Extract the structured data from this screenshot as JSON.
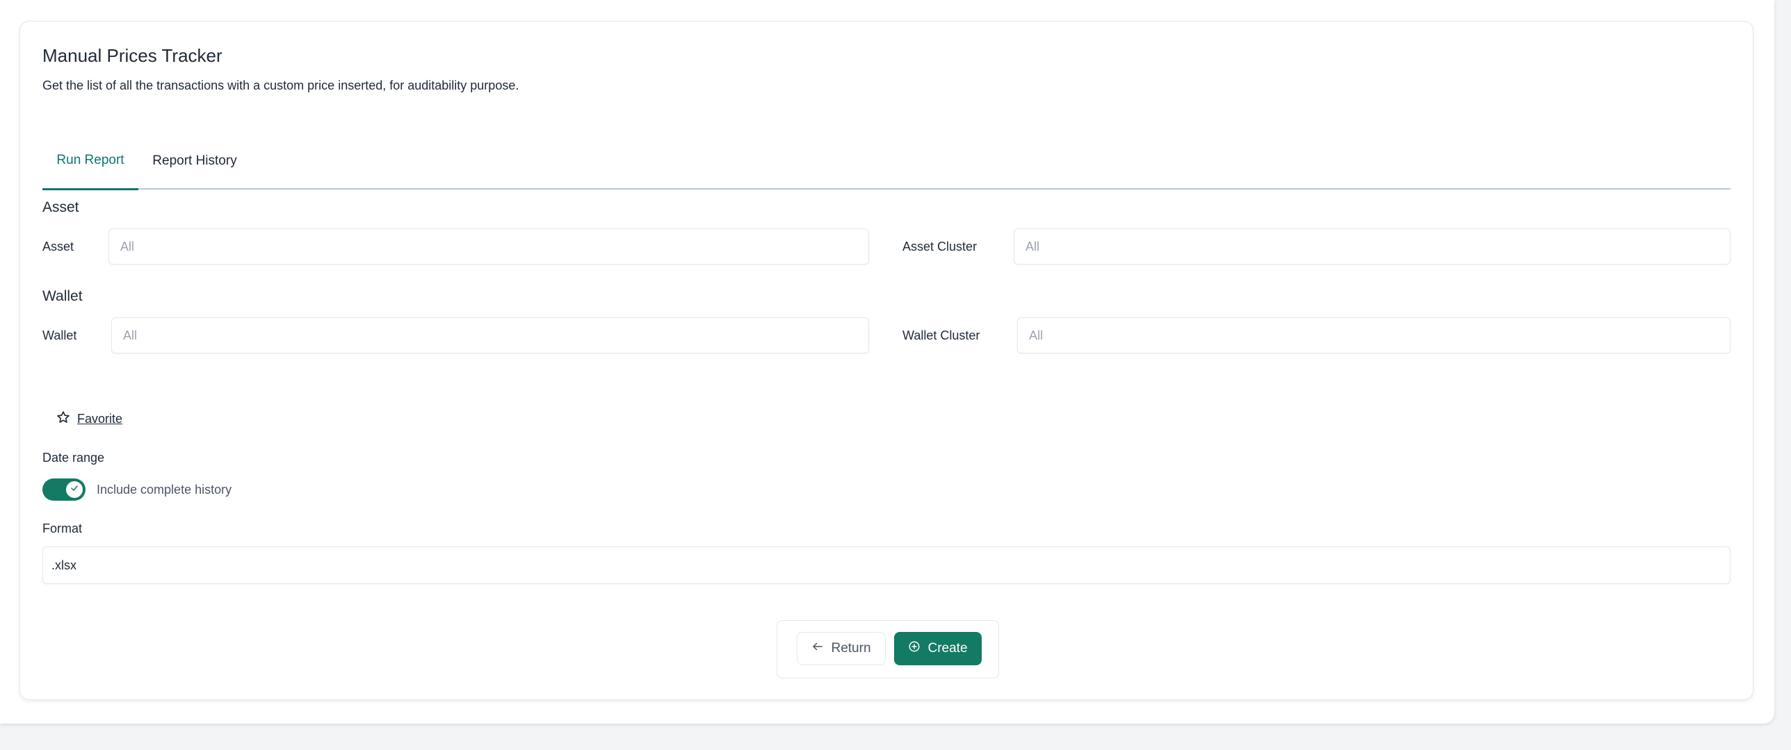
{
  "page": {
    "title": "Manual Prices Tracker",
    "subtitle": "Get the list of all the transactions with a custom price inserted, for auditability purpose."
  },
  "tabs": [
    {
      "label": "Run Report",
      "active": true
    },
    {
      "label": "Report History",
      "active": false
    }
  ],
  "asset_section": {
    "title": "Asset",
    "asset_label": "Asset",
    "asset_placeholder": "All",
    "cluster_label": "Asset Cluster",
    "cluster_placeholder": "All"
  },
  "wallet_section": {
    "title": "Wallet",
    "wallet_label": "Wallet",
    "wallet_placeholder": "All",
    "cluster_label": "Wallet Cluster",
    "cluster_placeholder": "All"
  },
  "favorite": {
    "label": "Favorite",
    "icon": "star-outline-icon"
  },
  "date_range": {
    "label": "Date range",
    "toggle_label": "Include complete history",
    "toggle_on": true
  },
  "format": {
    "label": "Format",
    "value": ".xlsx"
  },
  "actions": {
    "return_label": "Return",
    "create_label": "Create"
  },
  "colors": {
    "accent": "#137a63",
    "tab_active": "#0f766e"
  }
}
